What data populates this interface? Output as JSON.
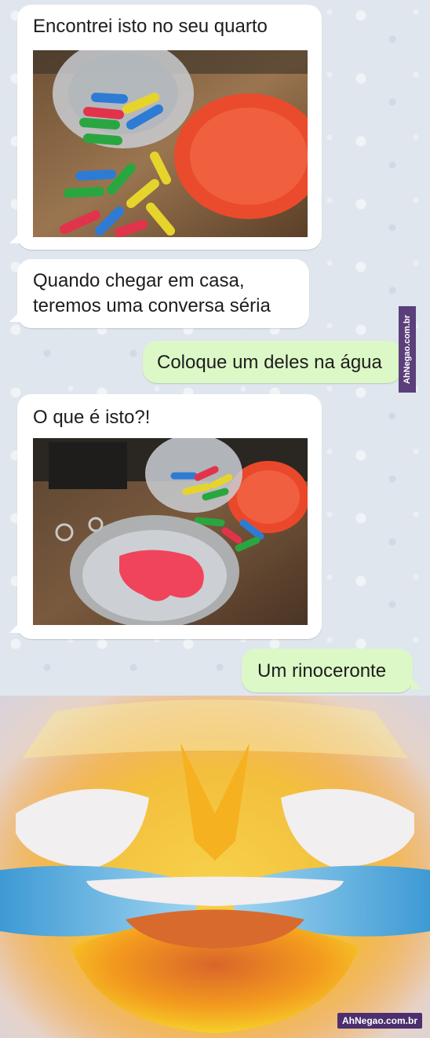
{
  "messages": [
    {
      "sender": "incoming",
      "text": "Encontrei isto no seu quarto",
      "photo": "pills-photo"
    },
    {
      "sender": "incoming",
      "text_line1": "Quando chegar em casa,",
      "text_line2": "teremos uma conversa séria"
    },
    {
      "sender": "outgoing",
      "text": "Coloque um deles na água"
    },
    {
      "sender": "incoming",
      "text": "O que é isto?!",
      "photo": "rhino-photo"
    },
    {
      "sender": "outgoing",
      "text": "Um rinoceronte"
    }
  ],
  "watermark": {
    "side": "AhNegao.com.br",
    "bottom": "AhNegao.com.br"
  },
  "meme": {
    "icon": "crying-laughing-emoji-icon"
  },
  "colors": {
    "incoming_bubble": "#ffffff",
    "outgoing_bubble": "#dcf8c6",
    "chat_background": "#dfe6ee",
    "watermark": "#4b2f6e"
  }
}
